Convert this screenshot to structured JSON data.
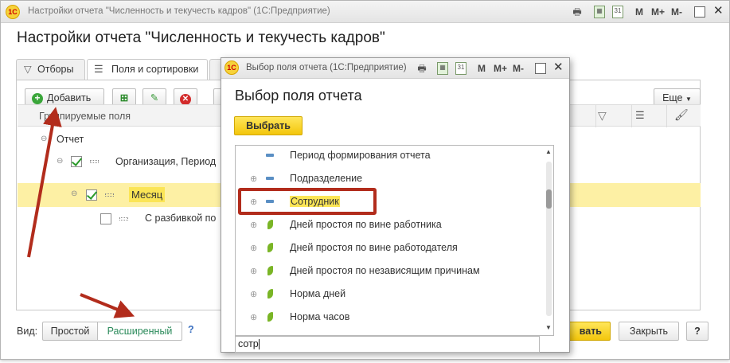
{
  "main_window": {
    "title": "Настройки отчета \"Численность и текучесть кадров\"",
    "app_name": "(1С:Предприятие)",
    "logo_text": "1С",
    "toolbar_m": "M",
    "toolbar_mplus": "M+",
    "toolbar_mminus": "M-",
    "calendar_day": "31"
  },
  "page_title": "Настройки отчета \"Численность и текучесть кадров\"",
  "tabs": [
    {
      "label": "Отборы",
      "icon": "filter-icon"
    },
    {
      "label": "Поля и сортировки",
      "icon": "fields-sort-icon"
    }
  ],
  "toolbar": {
    "add_label": "Добавить",
    "more_label": "Еще"
  },
  "grid": {
    "header": "Группируемые поля"
  },
  "tree": [
    {
      "label": "Отчет",
      "level": 0,
      "checkbox": false
    },
    {
      "label": "Организация, Период",
      "level": 1,
      "checkbox": true,
      "checked": true
    },
    {
      "label": "Месяц",
      "level": 2,
      "checkbox": true,
      "checked": true,
      "selected": true
    },
    {
      "label": "С разбивкой по",
      "level": 3,
      "checkbox": true,
      "checked": false
    }
  ],
  "footer": {
    "view_label": "Вид:",
    "simple_label": "Простой",
    "advanced_label": "Расширенный",
    "help_label": "?",
    "ok_partial_label": "вать",
    "close_label": "Закрыть",
    "help_button_label": "?"
  },
  "dialog": {
    "title": "Выбор поля отчета",
    "app_name": "(1С:Предприятие)",
    "heading": "Выбор поля отчета",
    "select_label": "Выбрать",
    "search_value": "сотр",
    "fields": [
      {
        "label": "Период формирования отчета",
        "expandable": false,
        "icon": "dimension-icon"
      },
      {
        "label": "Подразделение",
        "expandable": true,
        "icon": "dimension-icon"
      },
      {
        "label": "Сотрудник",
        "expandable": true,
        "icon": "dimension-icon",
        "highlighted": true
      },
      {
        "label": "Дней простоя по вине работника",
        "expandable": true,
        "icon": "resource-icon"
      },
      {
        "label": "Дней простоя по вине работодателя",
        "expandable": true,
        "icon": "resource-icon"
      },
      {
        "label": "Дней простоя по независящим причинам",
        "expandable": true,
        "icon": "resource-icon"
      },
      {
        "label": "Норма дней",
        "expandable": true,
        "icon": "resource-icon"
      },
      {
        "label": "Норма часов",
        "expandable": true,
        "icon": "resource-icon"
      }
    ]
  },
  "colors": {
    "accent_yellow": "#f5cc16",
    "highlight": "#fbe556",
    "selected_row": "#fdf0a4",
    "annotation_red": "#b22c1c",
    "check_green": "#2a9a2a"
  }
}
